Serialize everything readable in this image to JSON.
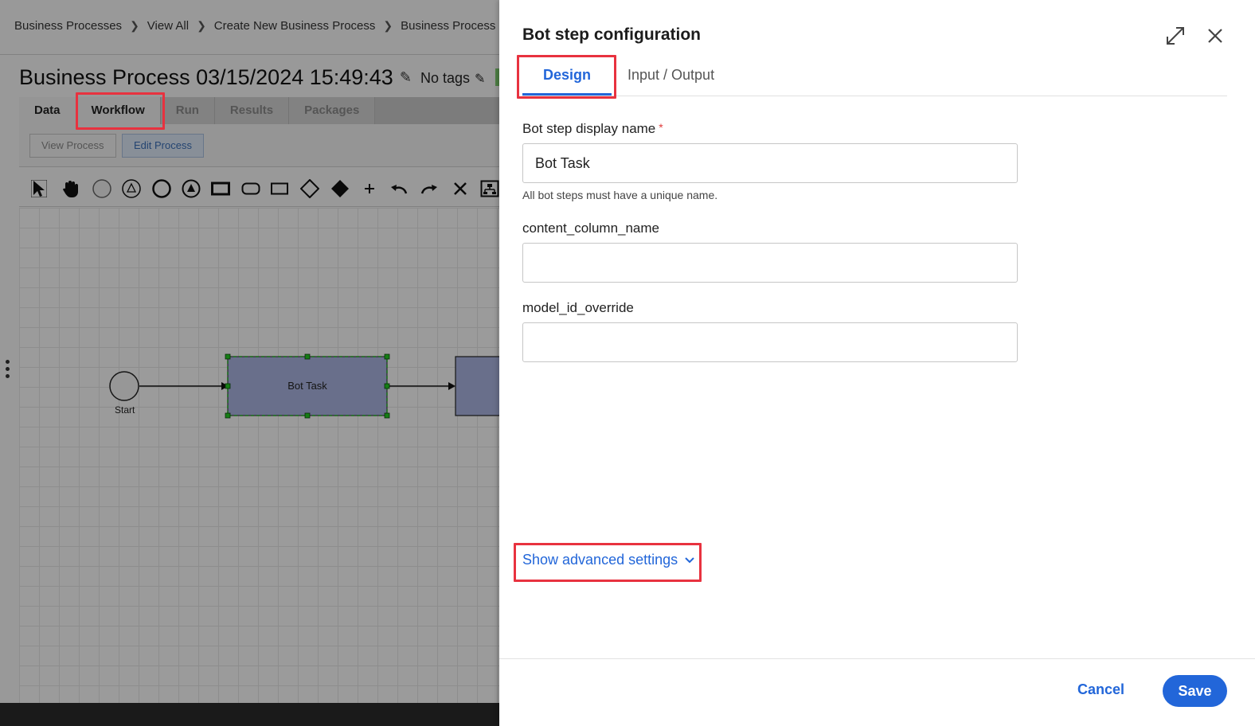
{
  "breadcrumb": {
    "items": [
      "Business Processes",
      "View All",
      "Create New Business Process",
      "Business Process"
    ]
  },
  "process": {
    "title": "Business Process 03/15/2024 15:49:43",
    "tags_label": "No tags"
  },
  "main_tabs": [
    "Data",
    "Workflow",
    "Run",
    "Results",
    "Packages"
  ],
  "sub_tabs": {
    "view": "View Process",
    "edit": "Edit Process"
  },
  "diagram": {
    "start_label": "Start",
    "task_label": "Bot Task"
  },
  "panel": {
    "title": "Bot step configuration",
    "tabs": {
      "design": "Design",
      "io": "Input / Output"
    },
    "fields": {
      "display_name_label": "Bot step display name",
      "required_marker": "*",
      "display_name_value": "Bot Task",
      "display_name_helper": "All bot steps must have a unique name.",
      "content_column_label": "content_column_name",
      "content_column_value": "",
      "model_id_label": "model_id_override",
      "model_id_value": ""
    },
    "advanced_link": "Show advanced settings",
    "cancel": "Cancel",
    "save": "Save"
  },
  "colors": {
    "accent": "#2266d9",
    "highlight": "#e8323f",
    "task_fill": "#aab4e0",
    "selection_handle": "#22aa22"
  }
}
